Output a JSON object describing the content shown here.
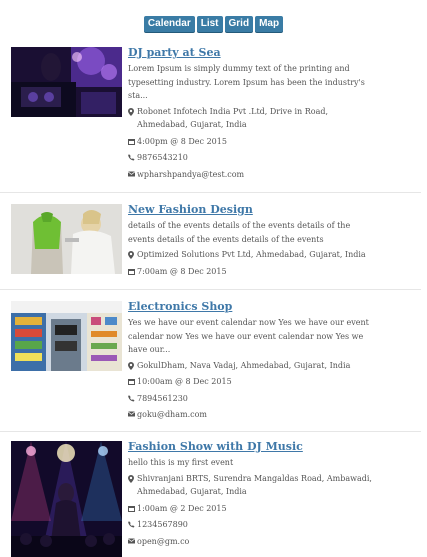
{
  "view_tabs": [
    "Calendar",
    "List",
    "Grid",
    "Map"
  ],
  "events": [
    {
      "title": "DJ party at Sea",
      "description": "Lorem Ipsum is simply dummy text of the printing and typesetting industry. Lorem Ipsum has been the industry's sta...",
      "address": "Robonet Infotech India Pvt .Ltd, Drive in Road, Ahmedabad, Gujarat, India",
      "datetime": "4:00pm @ 8 Dec 2015",
      "phone": "9876543210",
      "email": "wpharshpandya@test.com"
    },
    {
      "title": "New Fashion Design",
      "description": "details of the events details of the events details of the events details of the events details of the events",
      "address": "Optimized Solutions Pvt Ltd, Ahmedabad, Gujarat, India",
      "datetime": "7:00am @ 8 Dec 2015"
    },
    {
      "title": "Electronics Shop",
      "description": "Yes we have our event calendar now Yes we have our event calendar now Yes we have our event calendar now Yes we have our...",
      "address": "GokulDham, Nava Vadaj, Ahmedabad, Gujarat, India",
      "datetime": "10:00am @ 8 Dec 2015",
      "phone": "7894561230",
      "email": "goku@dham.com"
    },
    {
      "title": "Fashion Show with DJ Music",
      "description": "hello this is my first event",
      "address": "Shivranjani BRTS, Surendra Mangaldas Road, Ambawadi, Ahmedabad, Gujarat, India",
      "datetime": "1:00am @ 2 Dec 2015",
      "phone": "1234567890",
      "email": "open@gm.co"
    }
  ]
}
